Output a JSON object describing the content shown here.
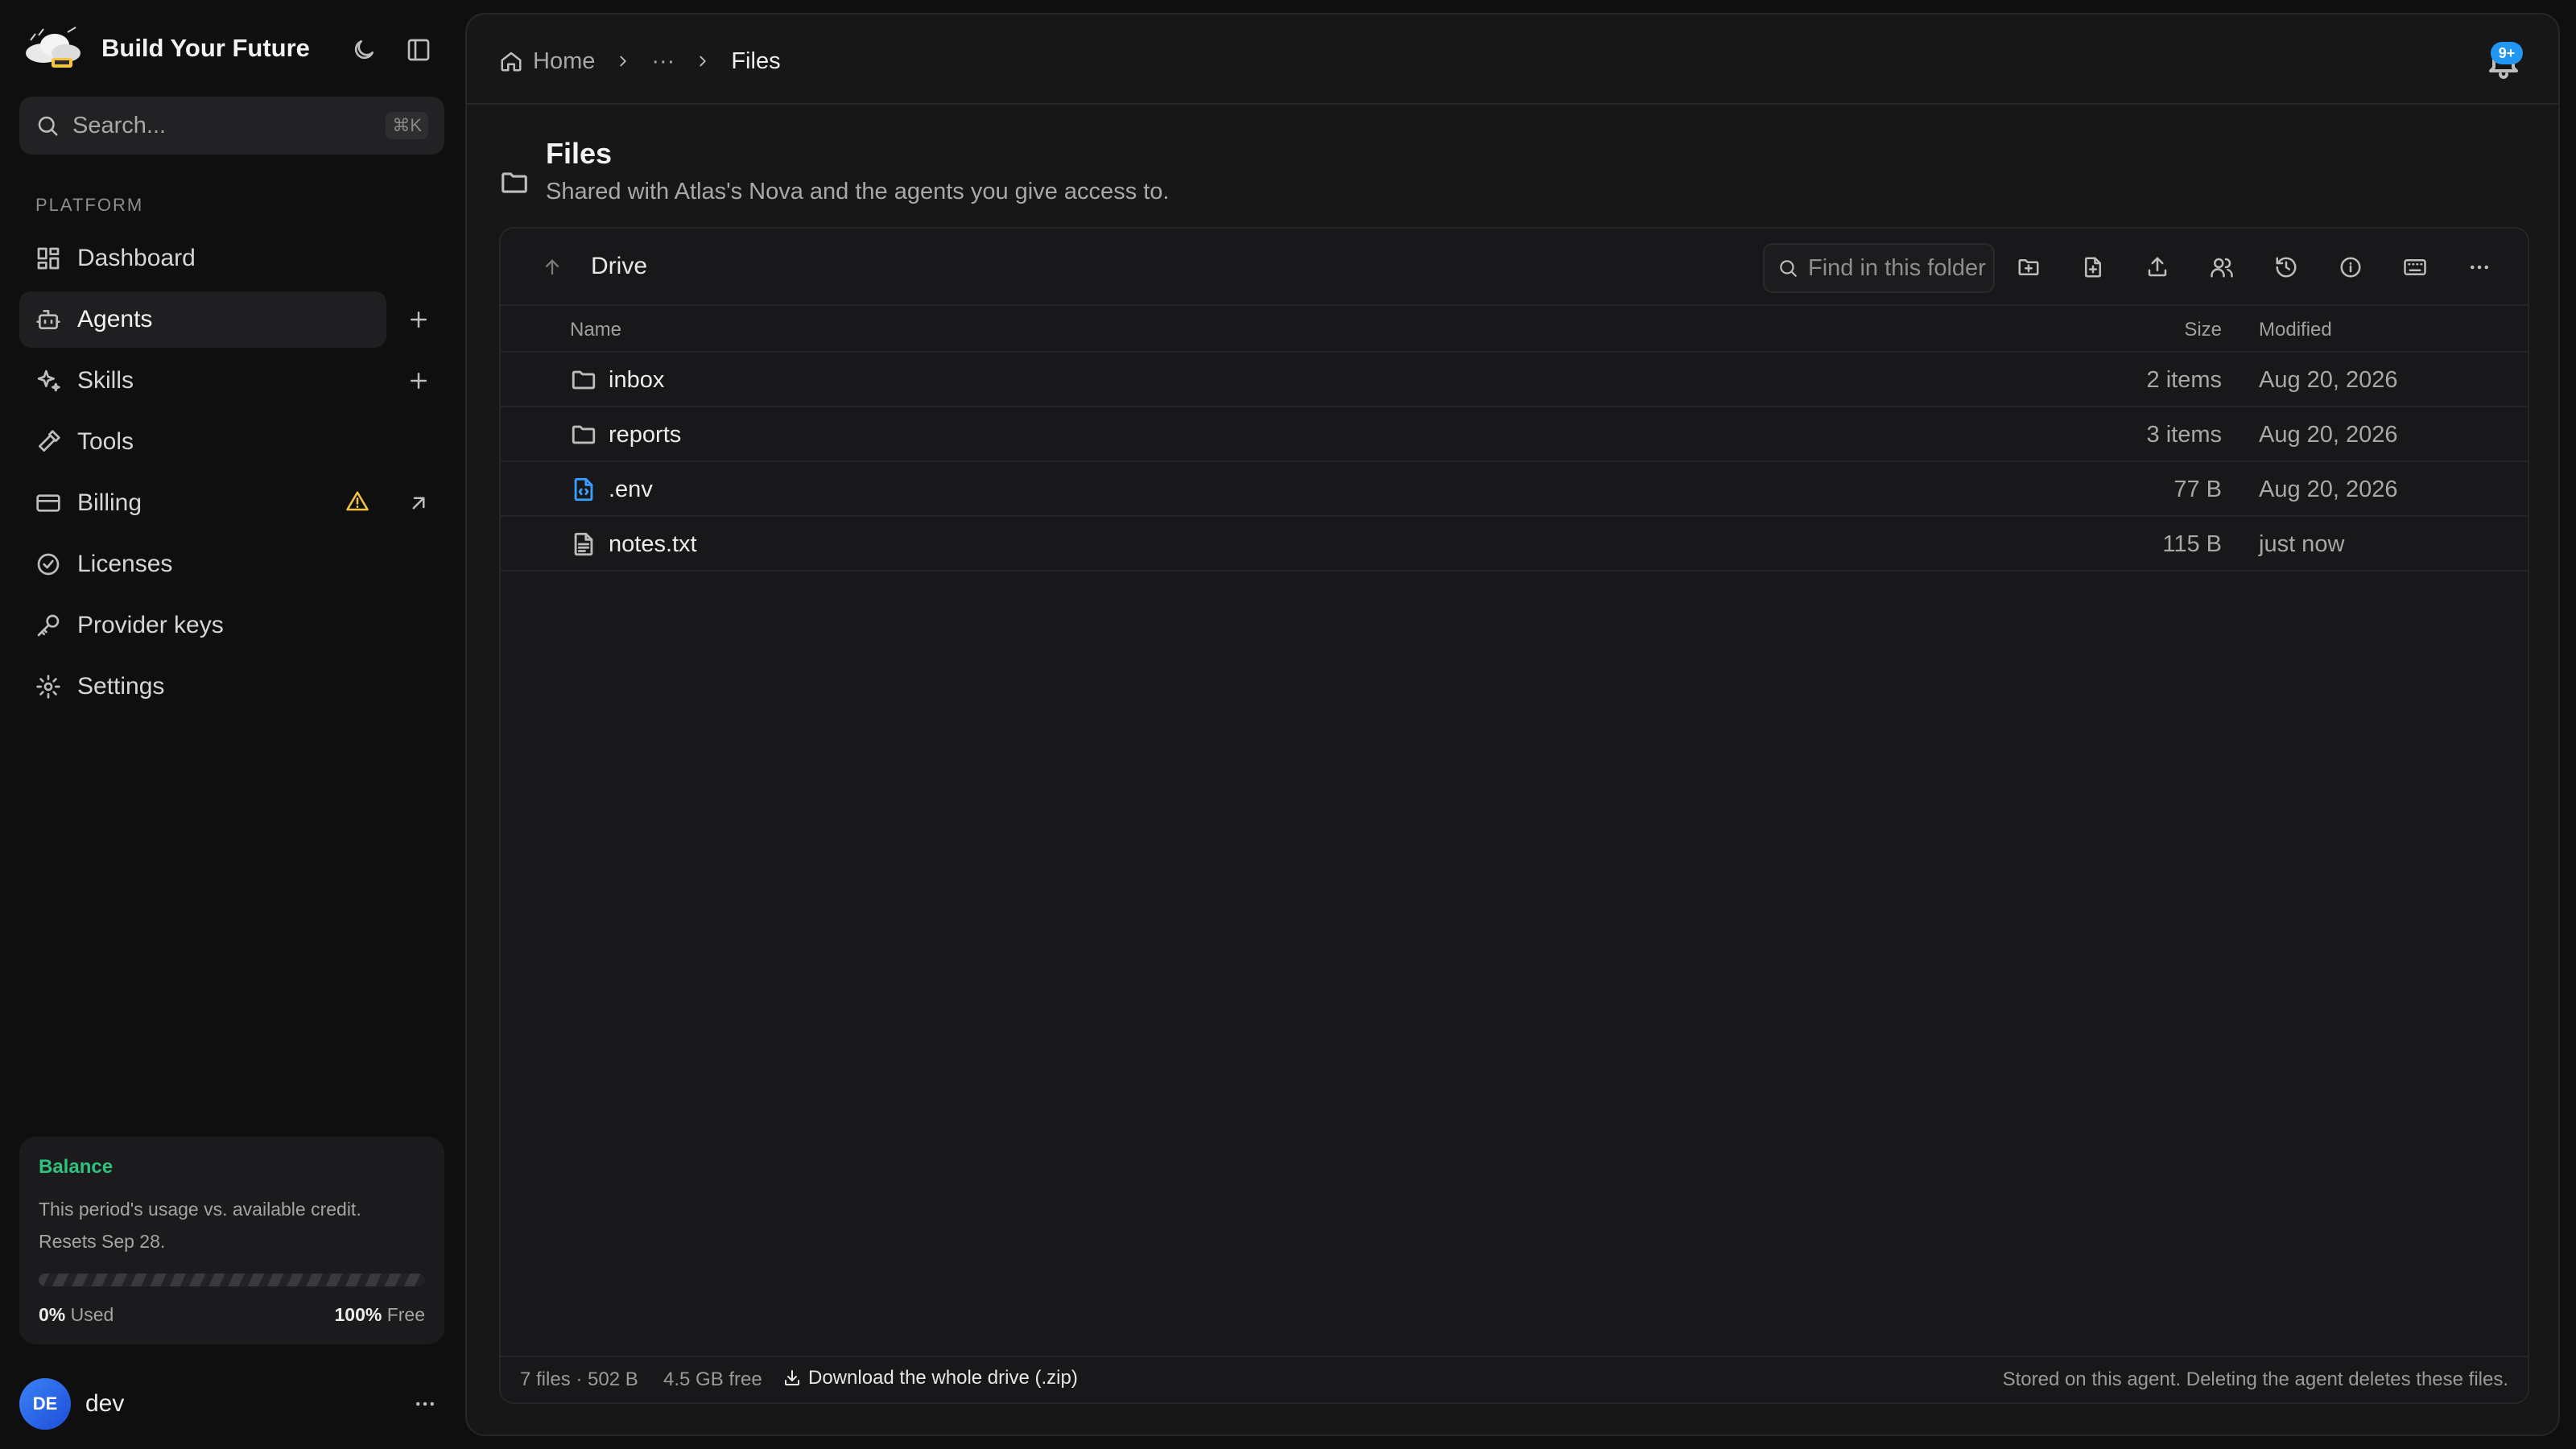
{
  "app": {
    "brand_name": "Build Your Future"
  },
  "search": {
    "placeholder": "Search...",
    "shortcut": "⌘K"
  },
  "sidebar": {
    "section_label": "PLATFORM",
    "items": [
      {
        "label": "Dashboard",
        "icon": "dashboard-icon",
        "active": false
      },
      {
        "label": "Agents",
        "icon": "bot-icon",
        "active": true
      },
      {
        "label": "Skills",
        "icon": "sparkles-icon",
        "active": false
      },
      {
        "label": "Tools",
        "icon": "hammer-icon",
        "active": false
      },
      {
        "label": "Billing",
        "icon": "credit-card-icon",
        "active": false
      },
      {
        "label": "Licenses",
        "icon": "badge-check-icon",
        "active": false
      },
      {
        "label": "Provider keys",
        "icon": "key-icon",
        "active": false
      },
      {
        "label": "Settings",
        "icon": "gear-icon",
        "active": false
      }
    ]
  },
  "balance": {
    "title": "Balance",
    "description": "This period's usage vs. available credit. Resets Sep 28.",
    "used_value": "0%",
    "used_label": "Used",
    "free_value": "100%",
    "free_label": "Free",
    "used_fraction": 0
  },
  "user": {
    "initials": "DE",
    "name": "dev"
  },
  "breadcrumb": {
    "home": "Home",
    "ellipsis": "···",
    "current": "Files"
  },
  "notifications": {
    "badge": "9+"
  },
  "files_page": {
    "title": "Files",
    "subtitle": "Shared with Atlas's Nova and the agents you give access to."
  },
  "browser": {
    "location": "Drive",
    "find_placeholder": "Find in this folder",
    "columns": {
      "name": "Name",
      "size": "Size",
      "modified": "Modified"
    },
    "rows": [
      {
        "name": "inbox",
        "size": "2 items",
        "modified": "Aug 20, 2026",
        "kind": "folder"
      },
      {
        "name": "reports",
        "size": "3 items",
        "modified": "Aug 20, 2026",
        "kind": "folder"
      },
      {
        "name": ".env",
        "size": "77 B",
        "modified": "Aug 20, 2026",
        "kind": "config-file"
      },
      {
        "name": "notes.txt",
        "size": "115 B",
        "modified": "just now",
        "kind": "text-file"
      }
    ],
    "footer": {
      "count": "7 files · 502 B",
      "free": "4.5 GB free",
      "download": "Download the whole drive (.zip)",
      "note": "Stored on this agent. Deleting the agent deletes these files."
    }
  },
  "colors": {
    "accent_green": "#2ec27e",
    "badge_blue": "#2196f3",
    "warning": "#f5c542",
    "env_icon": "#3b9eff"
  }
}
